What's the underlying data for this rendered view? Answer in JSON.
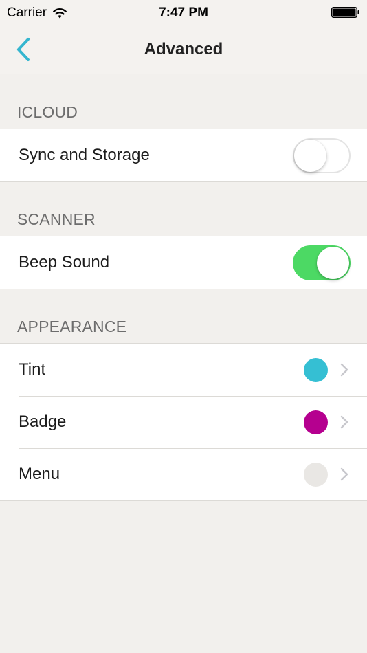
{
  "status_bar": {
    "carrier": "Carrier",
    "time": "7:47 PM",
    "wifi_icon": "wifi-icon",
    "battery_icon": "battery-icon"
  },
  "nav": {
    "back_icon": "chevron-left-icon",
    "title": "Advanced"
  },
  "sections": {
    "icloud": {
      "header": "ICLOUD",
      "sync_label": "Sync and Storage",
      "sync_on": false
    },
    "scanner": {
      "header": "SCANNER",
      "beep_label": "Beep Sound",
      "beep_on": true
    },
    "appearance": {
      "header": "APPEARANCE",
      "items": [
        {
          "label": "Tint",
          "color": "#35bfd3"
        },
        {
          "label": "Badge",
          "color": "#b5008f"
        },
        {
          "label": "Menu",
          "color": "#e9e7e4"
        }
      ]
    }
  },
  "colors": {
    "accent": "#35b6cf",
    "toggle_on": "#4cd964",
    "background": "#f2f0ed",
    "chevron": "#c7c7cc"
  }
}
